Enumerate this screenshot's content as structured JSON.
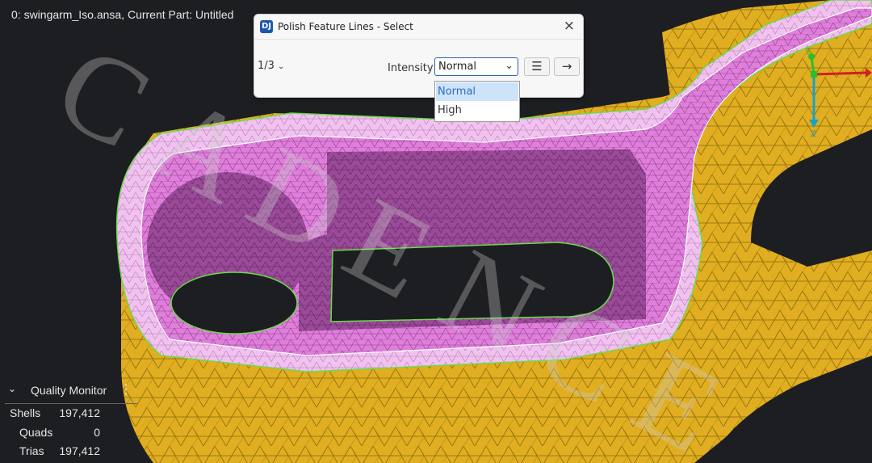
{
  "window": {
    "title": "0: swingarm_Iso.ansa,  Current Part: Untitled"
  },
  "dialog": {
    "title": "Polish Feature Lines - Select",
    "close_icon": "×",
    "pager": "1/3",
    "pager_chevron": "⌄",
    "intensity_label": "Intensity",
    "intensity_value": "Normal",
    "combo_chevron": "⌄",
    "list_button": "☰",
    "next_button": "→",
    "app_icon_text": "DJ"
  },
  "dropdown": {
    "options": [
      "Normal",
      "High"
    ],
    "selected": "Normal"
  },
  "quality_monitor": {
    "title": "Quality Monitor",
    "toggle": "⌄",
    "menu": "⋮",
    "rows": [
      {
        "label": "Shells",
        "value": "197,412"
      },
      {
        "label": "Quads",
        "value": "0"
      },
      {
        "label": "Trias",
        "value": "197,412"
      }
    ]
  },
  "axis_labels": {
    "y": "Y",
    "z": "Z"
  },
  "watermark": "CADENCE",
  "colors": {
    "background": "#1d1e22",
    "mesh_pink": "#e07fdc",
    "mesh_light_pink": "#f2bff0",
    "mesh_yellow": "#e3b422",
    "feature_line_green": "#6bdc4a",
    "accent_blue": "#2b62b8"
  }
}
